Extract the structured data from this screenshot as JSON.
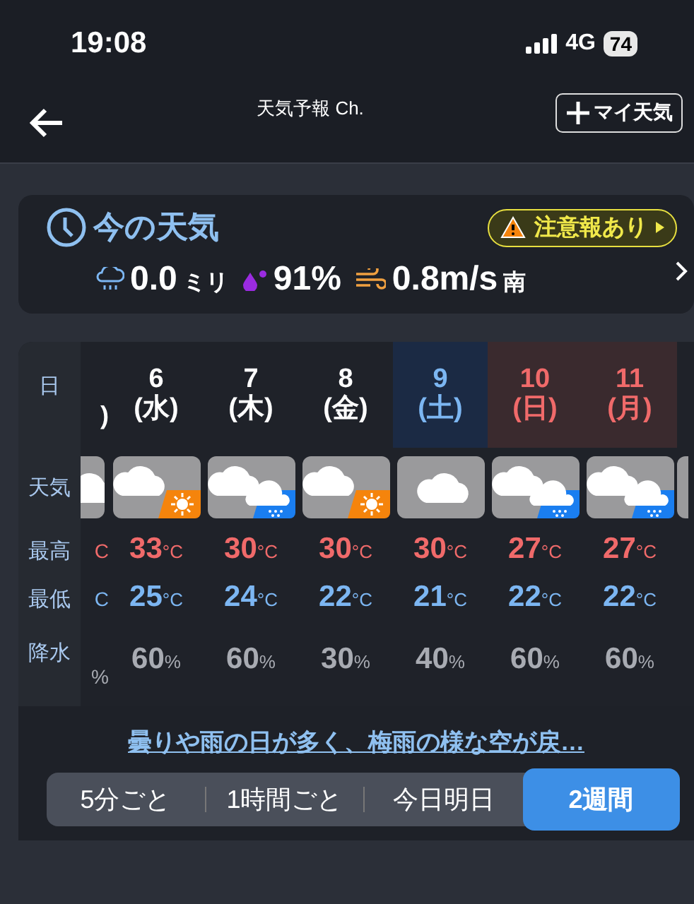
{
  "status_bar": {
    "time": "19:08",
    "network": "4G",
    "battery": "74"
  },
  "header": {
    "title": "天気予報 Ch.",
    "my_weather_button": "マイ天気"
  },
  "now": {
    "title": "今の天気",
    "alert": "注意報あり",
    "rain": {
      "value": "0.0",
      "unit": "ミリ"
    },
    "humidity": "91%",
    "wind": {
      "value": "0.8m/s",
      "direction": "南"
    }
  },
  "forecast": {
    "row_labels": {
      "date": "日",
      "weather": "天気",
      "high": "最高",
      "low": "最低",
      "rain": "降水"
    },
    "partial_column": {
      "weekday": ")",
      "high": "C",
      "low": "C",
      "rain": "%"
    },
    "days": [
      {
        "date": "6",
        "weekday": "(水)",
        "kind": "weekday",
        "icon": {
          "kind": "cloudy_sunny"
        },
        "high": "33",
        "high_unit": "°C",
        "low": "25",
        "low_unit": "°C",
        "rain": "60",
        "rain_unit": "%"
      },
      {
        "date": "7",
        "weekday": "(木)",
        "kind": "weekday",
        "icon": {
          "kind": "cloudy_rain"
        },
        "high": "30",
        "high_unit": "°C",
        "low": "24",
        "low_unit": "°C",
        "rain": "60",
        "rain_unit": "%"
      },
      {
        "date": "8",
        "weekday": "(金)",
        "kind": "weekday",
        "icon": {
          "kind": "cloudy_sunny"
        },
        "high": "30",
        "high_unit": "°C",
        "low": "22",
        "low_unit": "°C",
        "rain": "30",
        "rain_unit": "%"
      },
      {
        "date": "9",
        "weekday": "(土)",
        "kind": "saturday",
        "icon": {
          "kind": "cloudy"
        },
        "high": "30",
        "high_unit": "°C",
        "low": "21",
        "low_unit": "°C",
        "rain": "40",
        "rain_unit": "%"
      },
      {
        "date": "10",
        "weekday": "(日)",
        "kind": "holiday",
        "icon": {
          "kind": "cloudy_rain"
        },
        "high": "27",
        "high_unit": "°C",
        "low": "22",
        "low_unit": "°C",
        "rain": "60",
        "rain_unit": "%"
      },
      {
        "date": "11",
        "weekday": "(月)",
        "kind": "holiday",
        "icon": {
          "kind": "cloudy_rain"
        },
        "high": "27",
        "high_unit": "°C",
        "low": "22",
        "low_unit": "°C",
        "rain": "60",
        "rain_unit": "%"
      }
    ]
  },
  "summary_link": "曇りや雨の日が多く、梅雨の様な空が戻…",
  "tabs": [
    {
      "label": "5分ごと",
      "selected": false
    },
    {
      "label": "1時間ごと",
      "selected": false
    },
    {
      "label": "今日明日",
      "selected": false
    },
    {
      "label": "2週間",
      "selected": true
    }
  ]
}
